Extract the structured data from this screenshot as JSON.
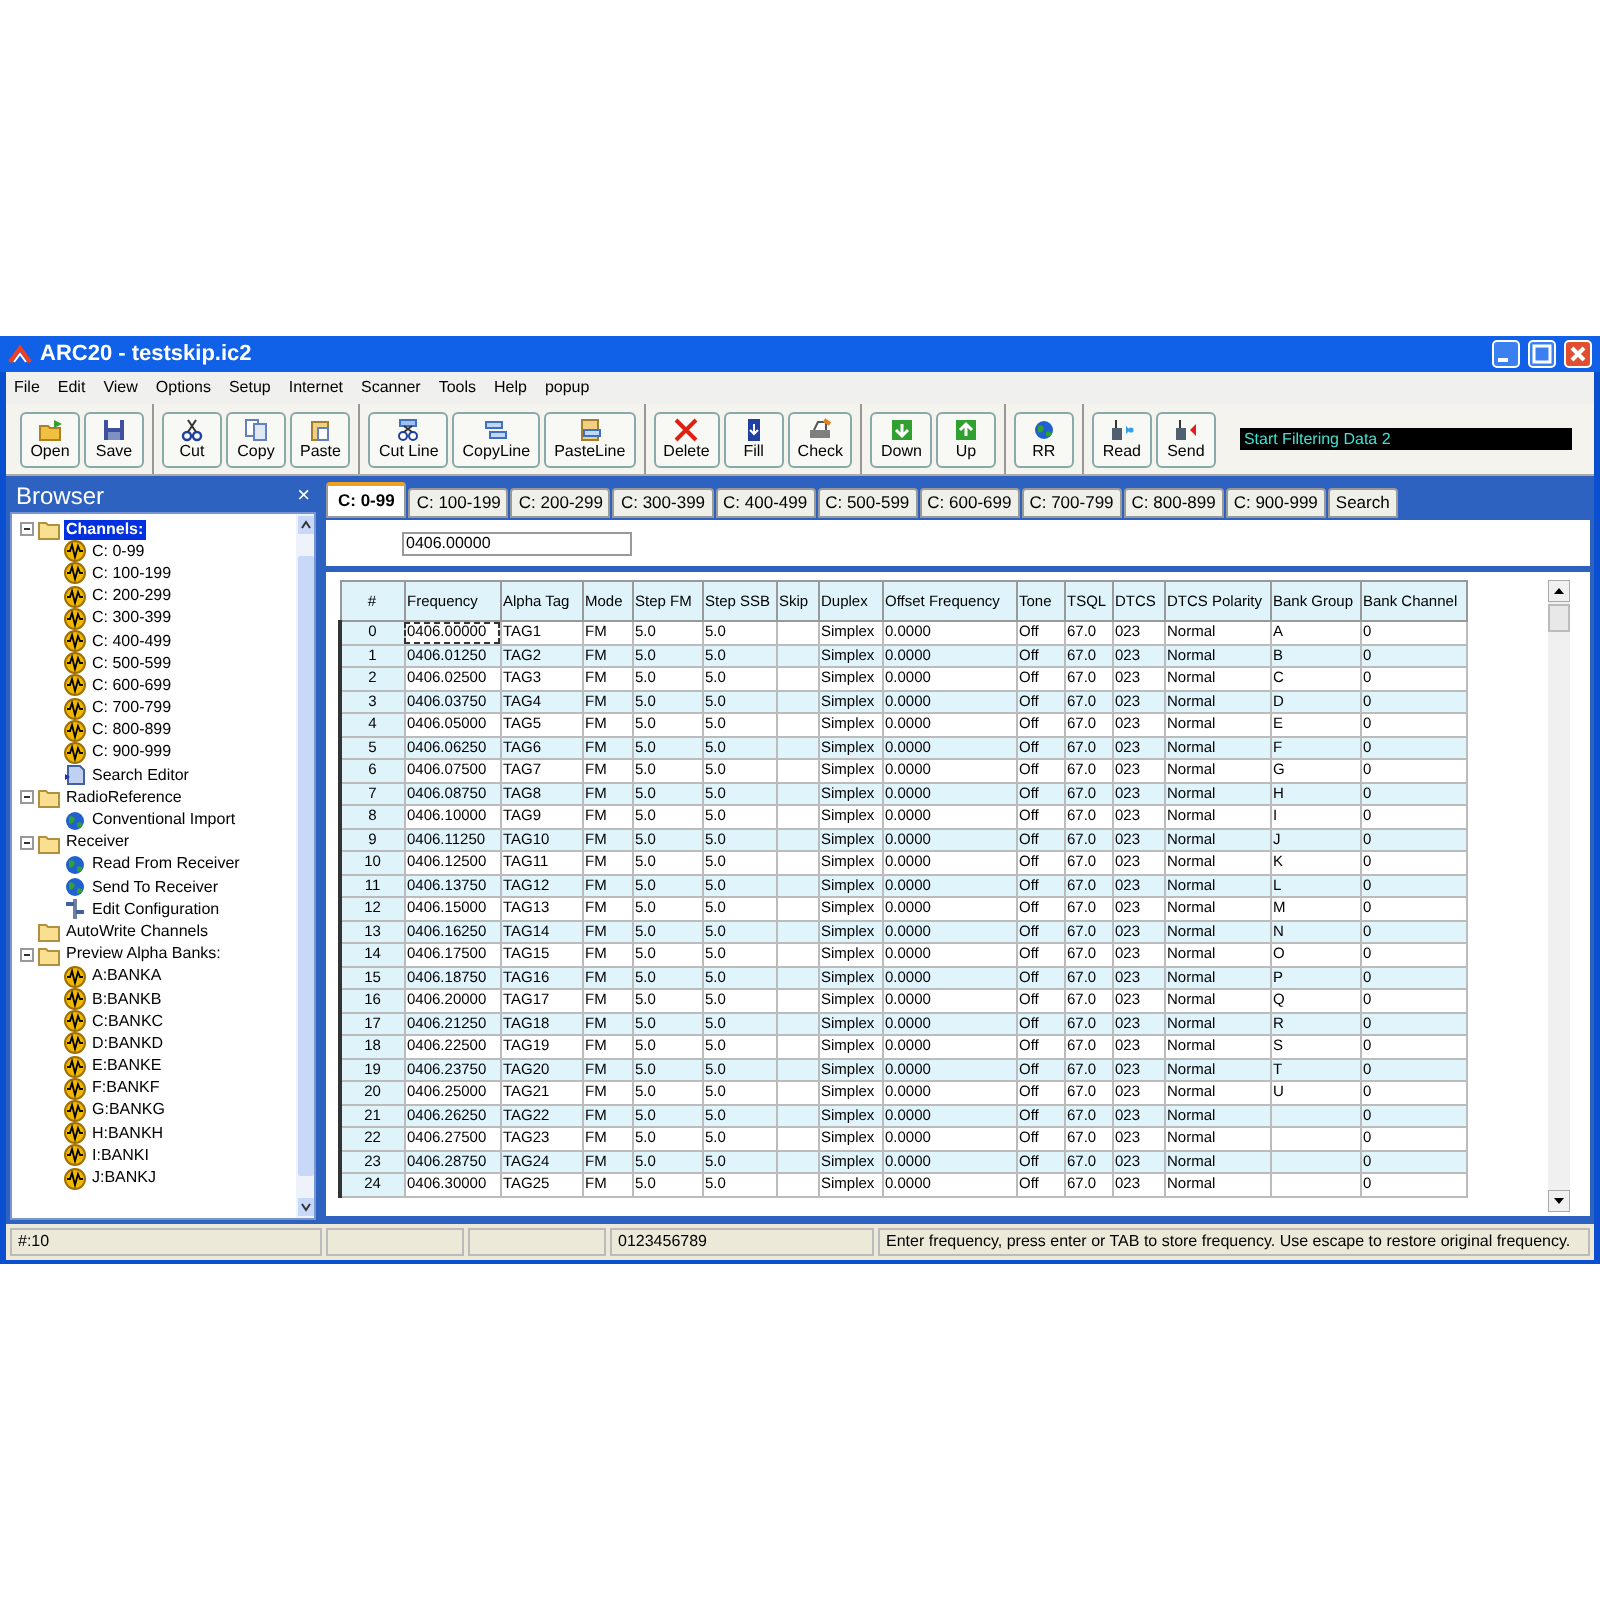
{
  "window": {
    "title": "ARC20 - testskip.ic2"
  },
  "menu": [
    "File",
    "Edit",
    "View",
    "Options",
    "Setup",
    "Internet",
    "Scanner",
    "Tools",
    "Help",
    "popup"
  ],
  "toolbar": {
    "groups": [
      [
        {
          "label": "Open",
          "kind": "open"
        },
        {
          "label": "Save",
          "kind": "save"
        }
      ],
      [
        {
          "label": "Cut",
          "kind": "cut"
        },
        {
          "label": "Copy",
          "kind": "copy"
        },
        {
          "label": "Paste",
          "kind": "paste"
        }
      ],
      [
        {
          "label": "Cut Line",
          "kind": "cutline"
        },
        {
          "label": "CopyLine",
          "kind": "copyline"
        },
        {
          "label": "PasteLine",
          "kind": "pasteline"
        }
      ],
      [
        {
          "label": "Delete",
          "kind": "delete"
        },
        {
          "label": "Fill",
          "kind": "fill"
        },
        {
          "label": "Check",
          "kind": "check"
        }
      ],
      [
        {
          "label": "Down",
          "kind": "down"
        },
        {
          "label": "Up",
          "kind": "up"
        }
      ],
      [
        {
          "label": "RR",
          "kind": "globe"
        }
      ],
      [
        {
          "label": "Read",
          "kind": "read"
        },
        {
          "label": "Send",
          "kind": "send"
        }
      ]
    ],
    "display": "Start Filtering Data 2"
  },
  "browser": {
    "title": "Browser",
    "close": "×",
    "tree": [
      {
        "label": "Channels:",
        "kind": "folder",
        "expanded": true,
        "selected": true,
        "children": [
          {
            "label": "C: 0-99",
            "kind": "channel",
            "selected": false
          },
          {
            "label": "C: 100-199",
            "kind": "channel",
            "selected": false
          },
          {
            "label": "C: 200-299",
            "kind": "channel",
            "selected": false
          },
          {
            "label": "C: 300-399",
            "kind": "channel",
            "selected": false
          },
          {
            "label": "C: 400-499",
            "kind": "channel",
            "selected": false
          },
          {
            "label": "C: 500-599",
            "kind": "channel",
            "selected": false
          },
          {
            "label": "C: 600-699",
            "kind": "channel",
            "selected": false
          },
          {
            "label": "C: 700-799",
            "kind": "channel",
            "selected": false
          },
          {
            "label": "C: 800-899",
            "kind": "channel",
            "selected": false
          },
          {
            "label": "C: 900-999",
            "kind": "channel",
            "selected": false
          },
          {
            "label": "Search Editor",
            "kind": "search",
            "selected": false
          }
        ]
      },
      {
        "label": "RadioReference",
        "kind": "folder",
        "expanded": true,
        "selected": false,
        "children": [
          {
            "label": "Conventional Import",
            "kind": "globe",
            "selected": false
          }
        ]
      },
      {
        "label": "Receiver",
        "kind": "folder",
        "expanded": true,
        "selected": false,
        "children": [
          {
            "label": "Read From Receiver",
            "kind": "globe",
            "selected": false
          },
          {
            "label": "Send To Receiver",
            "kind": "globe",
            "selected": false
          },
          {
            "label": "Edit Configuration",
            "kind": "config",
            "selected": false
          }
        ]
      },
      {
        "label": "AutoWrite Channels",
        "kind": "folder",
        "selected": false
      },
      {
        "label": "Preview Alpha Banks:",
        "kind": "folder",
        "expanded": true,
        "selected": false,
        "children": [
          {
            "label": "A:BANKA",
            "kind": "channel",
            "selected": false
          },
          {
            "label": "B:BANKB",
            "kind": "channel",
            "selected": false
          },
          {
            "label": "C:BANKC",
            "kind": "channel",
            "selected": false
          },
          {
            "label": "D:BANKD",
            "kind": "channel",
            "selected": false
          },
          {
            "label": "E:BANKE",
            "kind": "channel",
            "selected": false
          },
          {
            "label": "F:BANKF",
            "kind": "channel",
            "selected": false
          },
          {
            "label": "G:BANKG",
            "kind": "channel",
            "selected": false
          },
          {
            "label": "H:BANKH",
            "kind": "channel",
            "selected": false
          },
          {
            "label": "I:BANKI",
            "kind": "channel",
            "selected": false
          },
          {
            "label": "J:BANKJ",
            "kind": "channel",
            "selected": false
          }
        ]
      }
    ]
  },
  "tabs": [
    {
      "label": "C: 0-99",
      "selected": true
    },
    {
      "label": "C: 100-199",
      "selected": false
    },
    {
      "label": "C: 200-299",
      "selected": false
    },
    {
      "label": "C: 300-399",
      "selected": false
    },
    {
      "label": "C: 400-499",
      "selected": false
    },
    {
      "label": "C: 500-599",
      "selected": false
    },
    {
      "label": "C: 600-699",
      "selected": false
    },
    {
      "label": "C: 700-799",
      "selected": false
    },
    {
      "label": "C: 800-899",
      "selected": false
    },
    {
      "label": "C: 900-999",
      "selected": false
    },
    {
      "label": "Search",
      "selected": false
    }
  ],
  "frequency_field": {
    "value": "0406.00000"
  },
  "table": {
    "columns": [
      "#",
      "Frequency",
      "Alpha Tag",
      "Mode",
      "Step FM",
      "Step SSB",
      "Skip",
      "Duplex",
      "Offset Frequency",
      "Tone",
      "TSQL",
      "DTCS",
      "DTCS Polarity",
      "Bank Group",
      "Bank Channel"
    ],
    "rows": [
      {
        "focused": true,
        "cells": [
          "0",
          "0406.00000",
          "TAG1",
          "FM",
          "5.0",
          "5.0",
          null,
          "Simplex",
          "0.0000",
          "Off",
          "67.0",
          "023",
          "Normal",
          "A",
          "0"
        ]
      },
      {
        "focused": false,
        "cells": [
          "1",
          "0406.01250",
          "TAG2",
          "FM",
          "5.0",
          "5.0",
          null,
          "Simplex",
          "0.0000",
          "Off",
          "67.0",
          "023",
          "Normal",
          "B",
          "0"
        ]
      },
      {
        "focused": false,
        "cells": [
          "2",
          "0406.02500",
          "TAG3",
          "FM",
          "5.0",
          "5.0",
          null,
          "Simplex",
          "0.0000",
          "Off",
          "67.0",
          "023",
          "Normal",
          "C",
          "0"
        ]
      },
      {
        "focused": false,
        "cells": [
          "3",
          "0406.03750",
          "TAG4",
          "FM",
          "5.0",
          "5.0",
          null,
          "Simplex",
          "0.0000",
          "Off",
          "67.0",
          "023",
          "Normal",
          "D",
          "0"
        ]
      },
      {
        "focused": false,
        "cells": [
          "4",
          "0406.05000",
          "TAG5",
          "FM",
          "5.0",
          "5.0",
          null,
          "Simplex",
          "0.0000",
          "Off",
          "67.0",
          "023",
          "Normal",
          "E",
          "0"
        ]
      },
      {
        "focused": false,
        "cells": [
          "5",
          "0406.06250",
          "TAG6",
          "FM",
          "5.0",
          "5.0",
          null,
          "Simplex",
          "0.0000",
          "Off",
          "67.0",
          "023",
          "Normal",
          "F",
          "0"
        ]
      },
      {
        "focused": false,
        "cells": [
          "6",
          "0406.07500",
          "TAG7",
          "FM",
          "5.0",
          "5.0",
          null,
          "Simplex",
          "0.0000",
          "Off",
          "67.0",
          "023",
          "Normal",
          "G",
          "0"
        ]
      },
      {
        "focused": false,
        "cells": [
          "7",
          "0406.08750",
          "TAG8",
          "FM",
          "5.0",
          "5.0",
          null,
          "Simplex",
          "0.0000",
          "Off",
          "67.0",
          "023",
          "Normal",
          "H",
          "0"
        ]
      },
      {
        "focused": false,
        "cells": [
          "8",
          "0406.10000",
          "TAG9",
          "FM",
          "5.0",
          "5.0",
          null,
          "Simplex",
          "0.0000",
          "Off",
          "67.0",
          "023",
          "Normal",
          "I",
          "0"
        ]
      },
      {
        "focused": false,
        "cells": [
          "9",
          "0406.11250",
          "TAG10",
          "FM",
          "5.0",
          "5.0",
          null,
          "Simplex",
          "0.0000",
          "Off",
          "67.0",
          "023",
          "Normal",
          "J",
          "0"
        ]
      },
      {
        "focused": false,
        "cells": [
          "10",
          "0406.12500",
          "TAG11",
          "FM",
          "5.0",
          "5.0",
          null,
          "Simplex",
          "0.0000",
          "Off",
          "67.0",
          "023",
          "Normal",
          "K",
          "0"
        ]
      },
      {
        "focused": false,
        "cells": [
          "11",
          "0406.13750",
          "TAG12",
          "FM",
          "5.0",
          "5.0",
          null,
          "Simplex",
          "0.0000",
          "Off",
          "67.0",
          "023",
          "Normal",
          "L",
          "0"
        ]
      },
      {
        "focused": false,
        "cells": [
          "12",
          "0406.15000",
          "TAG13",
          "FM",
          "5.0",
          "5.0",
          null,
          "Simplex",
          "0.0000",
          "Off",
          "67.0",
          "023",
          "Normal",
          "M",
          "0"
        ]
      },
      {
        "focused": false,
        "cells": [
          "13",
          "0406.16250",
          "TAG14",
          "FM",
          "5.0",
          "5.0",
          null,
          "Simplex",
          "0.0000",
          "Off",
          "67.0",
          "023",
          "Normal",
          "N",
          "0"
        ]
      },
      {
        "focused": false,
        "cells": [
          "14",
          "0406.17500",
          "TAG15",
          "FM",
          "5.0",
          "5.0",
          null,
          "Simplex",
          "0.0000",
          "Off",
          "67.0",
          "023",
          "Normal",
          "O",
          "0"
        ]
      },
      {
        "focused": false,
        "cells": [
          "15",
          "0406.18750",
          "TAG16",
          "FM",
          "5.0",
          "5.0",
          null,
          "Simplex",
          "0.0000",
          "Off",
          "67.0",
          "023",
          "Normal",
          "P",
          "0"
        ]
      },
      {
        "focused": false,
        "cells": [
          "16",
          "0406.20000",
          "TAG17",
          "FM",
          "5.0",
          "5.0",
          null,
          "Simplex",
          "0.0000",
          "Off",
          "67.0",
          "023",
          "Normal",
          "Q",
          "0"
        ]
      },
      {
        "focused": false,
        "cells": [
          "17",
          "0406.21250",
          "TAG18",
          "FM",
          "5.0",
          "5.0",
          null,
          "Simplex",
          "0.0000",
          "Off",
          "67.0",
          "023",
          "Normal",
          "R",
          "0"
        ]
      },
      {
        "focused": false,
        "cells": [
          "18",
          "0406.22500",
          "TAG19",
          "FM",
          "5.0",
          "5.0",
          null,
          "Simplex",
          "0.0000",
          "Off",
          "67.0",
          "023",
          "Normal",
          "S",
          "0"
        ]
      },
      {
        "focused": false,
        "cells": [
          "19",
          "0406.23750",
          "TAG20",
          "FM",
          "5.0",
          "5.0",
          null,
          "Simplex",
          "0.0000",
          "Off",
          "67.0",
          "023",
          "Normal",
          "T",
          "0"
        ]
      },
      {
        "focused": false,
        "cells": [
          "20",
          "0406.25000",
          "TAG21",
          "FM",
          "5.0",
          "5.0",
          null,
          "Simplex",
          "0.0000",
          "Off",
          "67.0",
          "023",
          "Normal",
          "U",
          "0"
        ]
      },
      {
        "focused": false,
        "cells": [
          "21",
          "0406.26250",
          "TAG22",
          "FM",
          "5.0",
          "5.0",
          null,
          "Simplex",
          "0.0000",
          "Off",
          "67.0",
          "023",
          "Normal",
          null,
          "0"
        ]
      },
      {
        "focused": false,
        "cells": [
          "22",
          "0406.27500",
          "TAG23",
          "FM",
          "5.0",
          "5.0",
          null,
          "Simplex",
          "0.0000",
          "Off",
          "67.0",
          "023",
          "Normal",
          null,
          "0"
        ]
      },
      {
        "focused": false,
        "cells": [
          "23",
          "0406.28750",
          "TAG24",
          "FM",
          "5.0",
          "5.0",
          null,
          "Simplex",
          "0.0000",
          "Off",
          "67.0",
          "023",
          "Normal",
          null,
          "0"
        ]
      },
      {
        "focused": false,
        "cells": [
          "24",
          "0406.30000",
          "TAG25",
          "FM",
          "5.0",
          "5.0",
          null,
          "Simplex",
          "0.0000",
          "Off",
          "67.0",
          "023",
          "Normal",
          null,
          "0"
        ]
      }
    ]
  },
  "status_bar": {
    "count": "#:10",
    "digits": "0123456789",
    "message": "Enter frequency, press enter or TAB to store frequency. Use escape to restore original frequency."
  }
}
